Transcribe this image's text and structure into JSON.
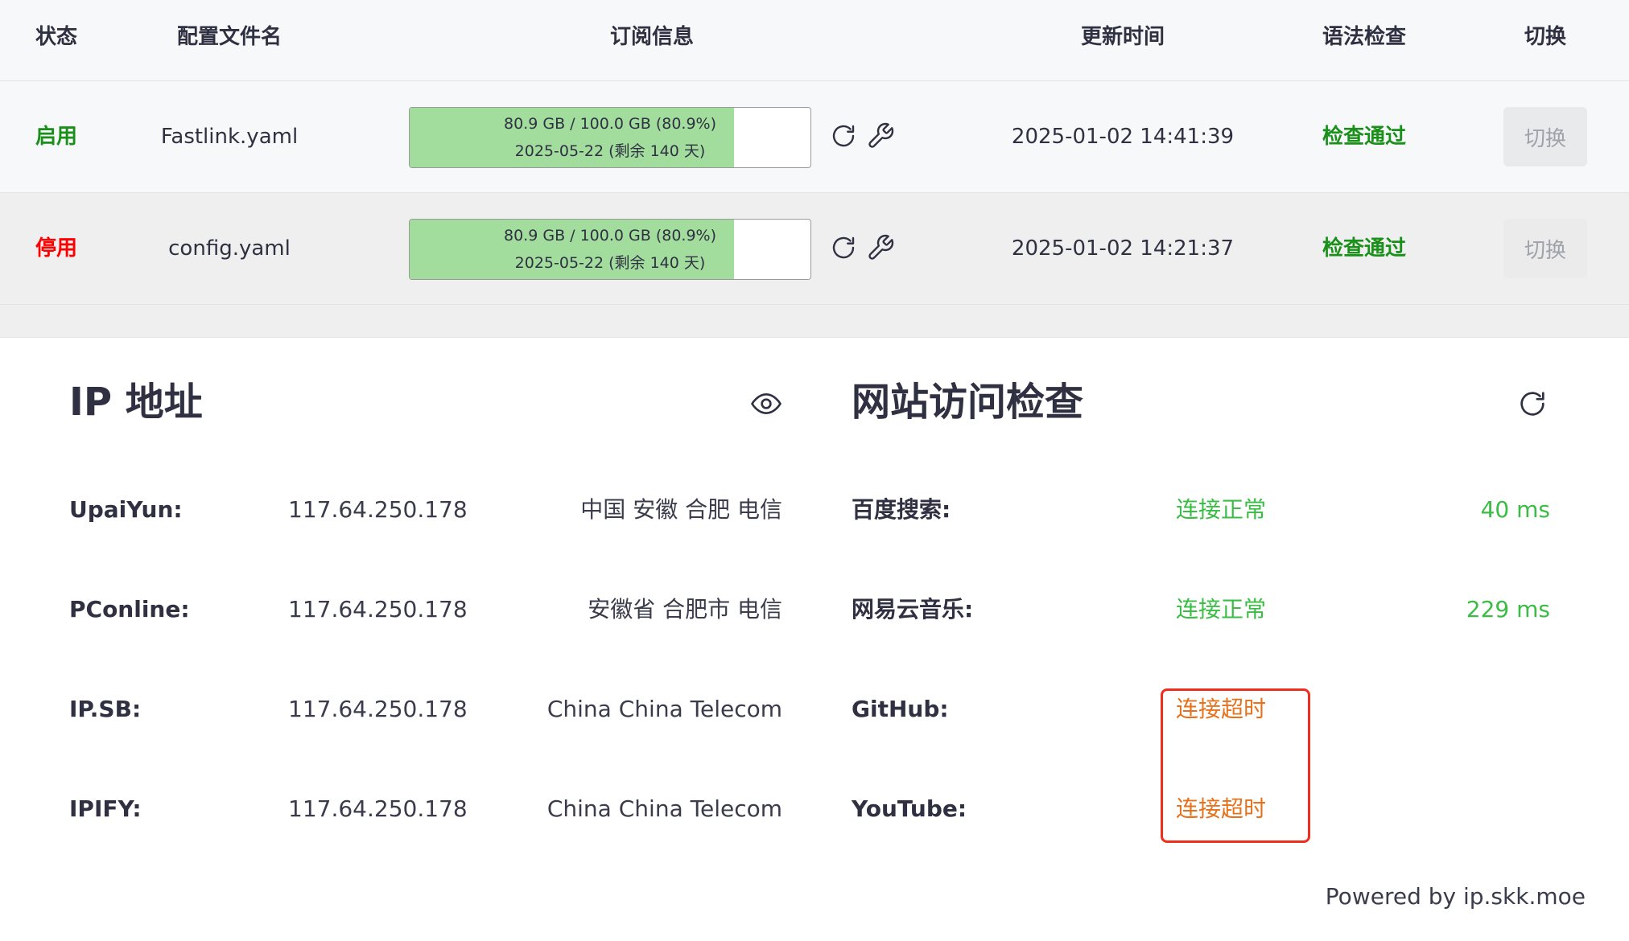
{
  "table": {
    "headers": {
      "status": "状态",
      "name": "配置文件名",
      "subscription": "订阅信息",
      "updated": "更新时间",
      "syntax": "语法检查",
      "switch": "切换"
    },
    "rows": [
      {
        "status": "启用",
        "name": "Fastlink.yaml",
        "usage_line": "80.9 GB / 100.0 GB (80.9%)",
        "expiry_line": "2025-05-22 (剩余 140 天)",
        "usage_fraction": 0.809,
        "updated": "2025-01-02 14:41:39",
        "syntax": "检查通过",
        "switch_label": "切换"
      },
      {
        "status": "停用",
        "name": "config.yaml",
        "usage_line": "80.9 GB / 100.0 GB (80.9%)",
        "expiry_line": "2025-05-22 (剩余 140 天)",
        "usage_fraction": 0.809,
        "updated": "2025-01-02 14:21:37",
        "syntax": "检查通过",
        "switch_label": "切换"
      }
    ]
  },
  "ip_panel": {
    "title": "IP 地址",
    "icon": "eye-icon",
    "rows": [
      {
        "label": "UpaiYun:",
        "ip": "117.64.250.178",
        "location": "中国 安徽 合肥 电信"
      },
      {
        "label": "PConline:",
        "ip": "117.64.250.178",
        "location": "安徽省 合肥市 电信"
      },
      {
        "label": "IP.SB:",
        "ip": "117.64.250.178",
        "location": "China China Telecom"
      },
      {
        "label": "IPIFY:",
        "ip": "117.64.250.178",
        "location": "China China Telecom"
      }
    ]
  },
  "web_panel": {
    "title": "网站访问检查",
    "icon": "refresh-icon",
    "rows": [
      {
        "label": "百度搜索:",
        "status": "连接正常",
        "latency": "40 ms"
      },
      {
        "label": "网易云音乐:",
        "status": "连接正常",
        "latency": "229 ms"
      },
      {
        "label": "GitHub:",
        "status": "连接超时",
        "latency": ""
      },
      {
        "label": "YouTube:",
        "status": "连接超时",
        "latency": ""
      }
    ]
  },
  "footer": {
    "powered_by": "Powered by ip.skk.moe"
  },
  "colors": {
    "enabled": "#1a8f1a",
    "disabled": "#ff0000",
    "ok": "#3bbd45",
    "timeout": "#e5731e",
    "highlight": "#ef2e1e",
    "usage_fill": "#a2dd9d"
  }
}
